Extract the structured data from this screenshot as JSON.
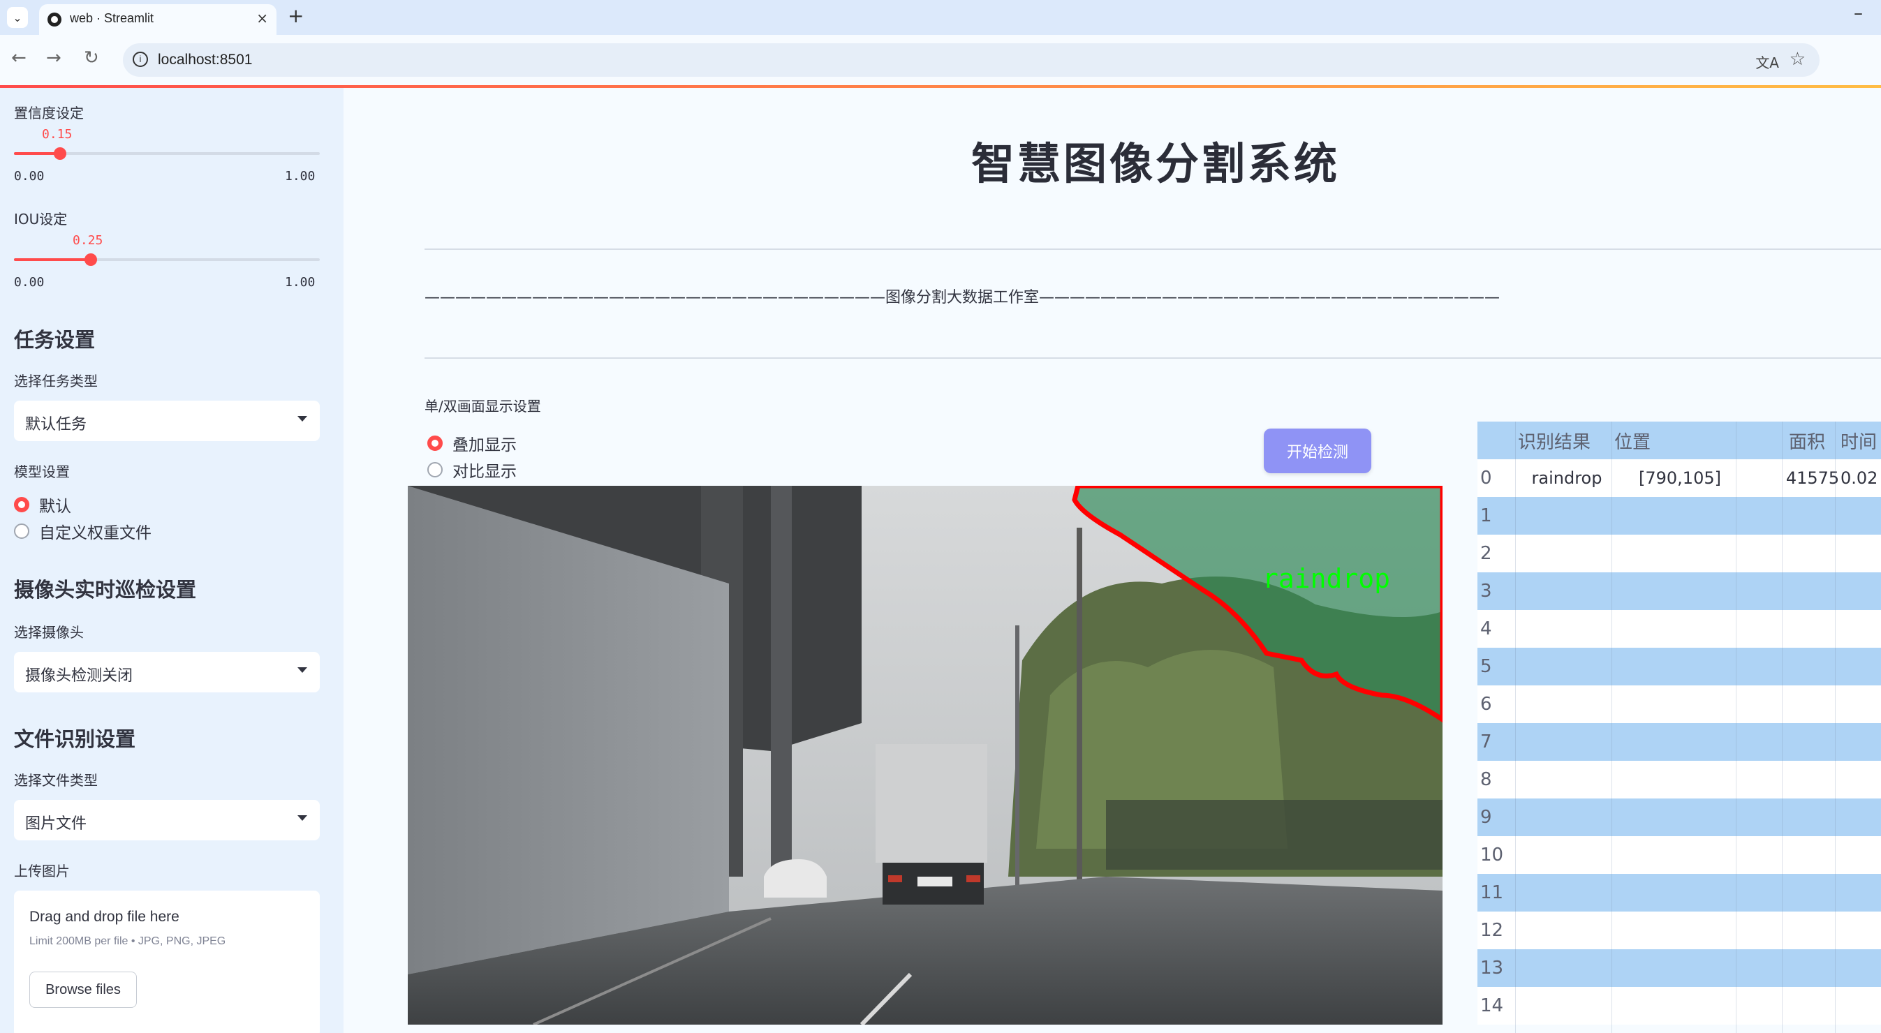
{
  "browser": {
    "tab_title": "web · Streamlit",
    "tab_close": "×",
    "new_tab": "+",
    "minimize": "–",
    "url": "localhost:8501"
  },
  "sidebar": {
    "confidence": {
      "label": "置信度设定",
      "value": "0.15",
      "level": 0.15,
      "min": "0.00",
      "max": "1.00"
    },
    "iou": {
      "label": "IOU设定",
      "value": "0.25",
      "level": 0.25,
      "min": "0.00",
      "max": "1.00"
    },
    "task_heading": "任务设置",
    "task_type_label": "选择任务类型",
    "task_type_value": "默认任务",
    "model_label": "模型设置",
    "model_options": [
      "默认",
      "自定义权重文件"
    ],
    "camera_heading": "摄像头实时巡检设置",
    "camera_label": "选择摄像头",
    "camera_value": "摄像头检测关闭",
    "file_heading": "文件识别设置",
    "file_type_label": "选择文件类型",
    "file_type_value": "图片文件",
    "upload_label": "上传图片",
    "upload_title": "Drag and drop file here",
    "upload_limit": "Limit 200MB per file • JPG, PNG, JPEG",
    "browse_label": "Browse files"
  },
  "main": {
    "title": "智慧图像分割系统",
    "subtitle": "——————————————————————————————图像分割大数据工作室——————————————————————————————",
    "mode_label": "单/双画面显示设置",
    "mode_options": [
      "叠加显示",
      "对比显示"
    ],
    "start_button": "开始检测",
    "detection_label": "raindrop"
  },
  "table": {
    "headers": [
      "",
      "识别结果",
      "位置",
      "面积",
      "时间"
    ],
    "rows": [
      [
        "0",
        "raindrop",
        "[790,105]",
        "41575",
        "0.02"
      ],
      [
        "1",
        "",
        "",
        "",
        ""
      ],
      [
        "2",
        "",
        "",
        "",
        ""
      ],
      [
        "3",
        "",
        "",
        "",
        ""
      ],
      [
        "4",
        "",
        "",
        "",
        ""
      ],
      [
        "5",
        "",
        "",
        "",
        ""
      ],
      [
        "6",
        "",
        "",
        "",
        ""
      ],
      [
        "7",
        "",
        "",
        "",
        ""
      ],
      [
        "8",
        "",
        "",
        "",
        ""
      ],
      [
        "9",
        "",
        "",
        "",
        ""
      ],
      [
        "10",
        "",
        "",
        "",
        ""
      ],
      [
        "11",
        "",
        "",
        "",
        ""
      ],
      [
        "12",
        "",
        "",
        "",
        ""
      ],
      [
        "13",
        "",
        "",
        "",
        ""
      ],
      [
        "14",
        "",
        "",
        "",
        ""
      ]
    ]
  },
  "colors": {
    "accent": "#ff4b4b",
    "button": "#8f93f5",
    "mask": "#2e8b57",
    "mask_outline": "#ff0000",
    "label": "#00ff00"
  }
}
